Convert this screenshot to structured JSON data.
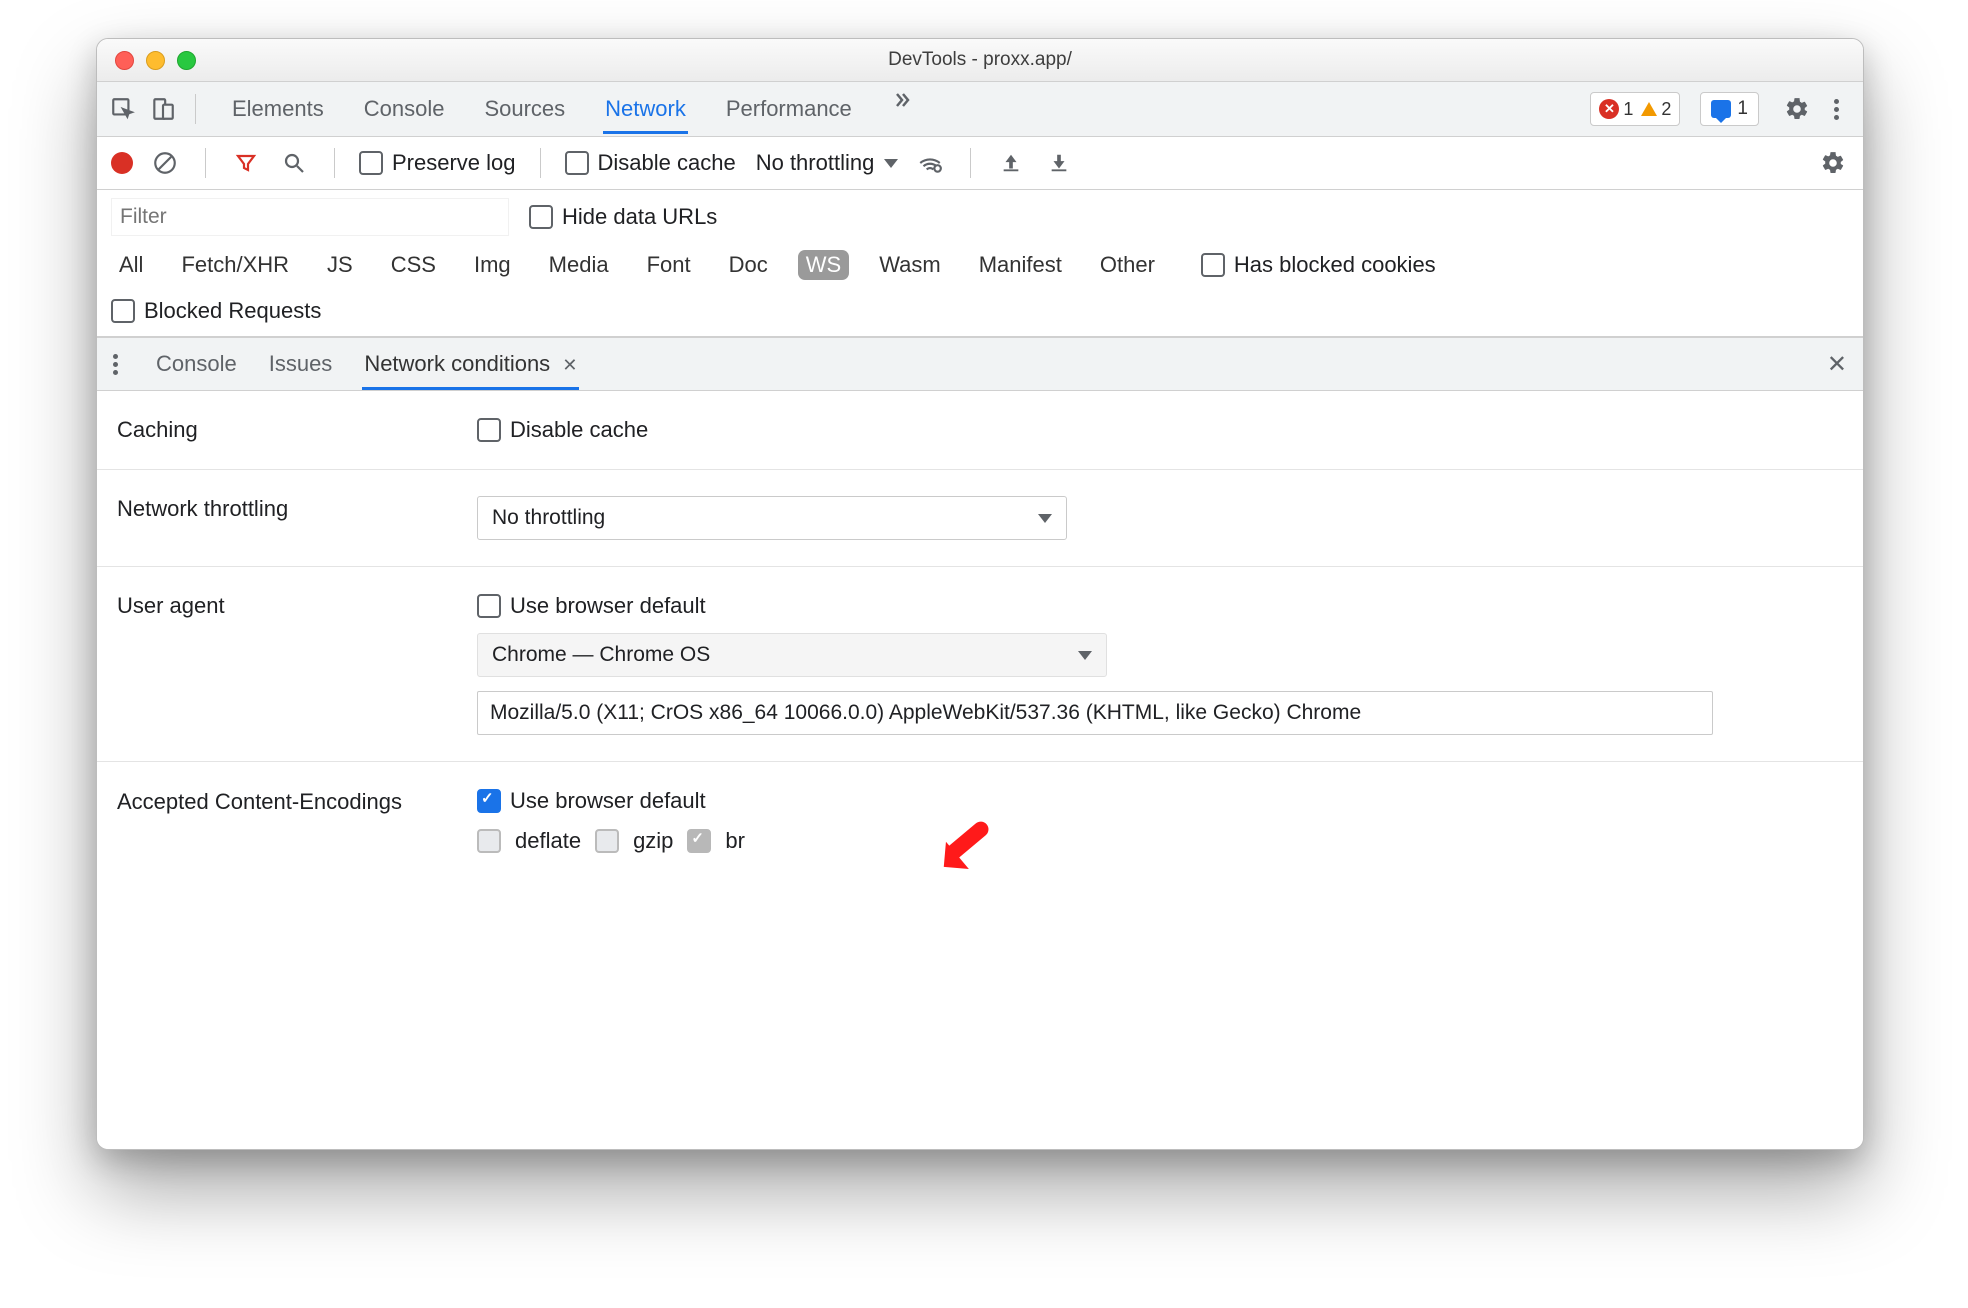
{
  "title": "DevTools - proxx.app/",
  "topbar": {
    "tabs": [
      "Elements",
      "Console",
      "Sources",
      "Network",
      "Performance"
    ],
    "activeTab": "Network",
    "overflow_icon": "chevrons-right-icon",
    "errors_count": "1",
    "warnings_count": "2",
    "messages_count": "1"
  },
  "networkToolbar": {
    "preserve_log": "Preserve log",
    "disable_cache": "Disable cache",
    "throttling_label": "No throttling"
  },
  "filter": {
    "placeholder": "Filter",
    "hide_data_urls": "Hide data URLs",
    "types": [
      "All",
      "Fetch/XHR",
      "JS",
      "CSS",
      "Img",
      "Media",
      "Font",
      "Doc",
      "WS",
      "Wasm",
      "Manifest",
      "Other"
    ],
    "selected_type": "WS",
    "has_blocked_cookies": "Has blocked cookies",
    "blocked_requests": "Blocked Requests"
  },
  "drawer": {
    "tabs": [
      "Console",
      "Issues",
      "Network conditions"
    ],
    "active": "Network conditions"
  },
  "settings": {
    "caching_label": "Caching",
    "caching_checkbox": "Disable cache",
    "throttling_label": "Network throttling",
    "throttling_value": "No throttling",
    "ua_label": "User agent",
    "ua_checkbox": "Use browser default",
    "ua_select": "Chrome — Chrome OS",
    "ua_string": "Mozilla/5.0 (X11; CrOS x86_64 10066.0.0) AppleWebKit/537.36 (KHTML, like Gecko) Chrome",
    "enc_label": "Accepted Content-Encodings",
    "enc_checkbox": "Use browser default",
    "enc_options": [
      "deflate",
      "gzip",
      "br"
    ]
  }
}
